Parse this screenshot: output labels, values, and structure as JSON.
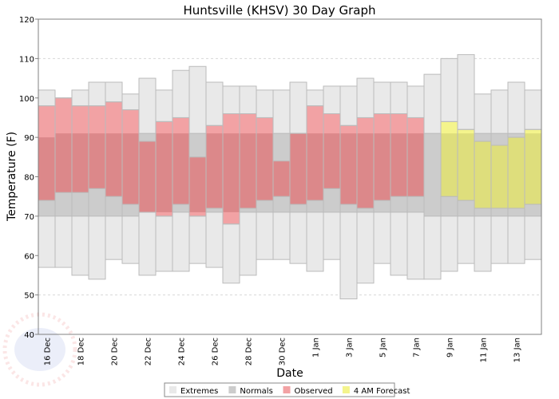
{
  "chart_data": {
    "type": "bar",
    "subtype": "floating-range",
    "title": "Huntsville (KHSV) 30 Day Graph",
    "xlabel": "Date",
    "ylabel": "Temperature (F)",
    "ylim": [
      40,
      120
    ],
    "yticks": [
      40,
      50,
      60,
      70,
      80,
      90,
      100,
      110,
      120
    ],
    "grid": true,
    "legend_position": "bottom-center",
    "legend": [
      {
        "key": "extremes",
        "label": "Extremes",
        "color": "#E9E9E9"
      },
      {
        "key": "normals",
        "label": "Normals",
        "color": "#CCCCCC"
      },
      {
        "key": "observed",
        "label": "Observed",
        "color": "#F2A2A4"
      },
      {
        "key": "forecast",
        "label": "4 AM Forecast",
        "color": "#F4F48C"
      }
    ],
    "colors": {
      "extremes": "#E9E9E9",
      "normals": "#CCCCCC",
      "observed": "#F2A2A4",
      "observed_overlap": "#DC888A",
      "forecast": "#F4F48C",
      "forecast_overlap": "#DEDE7C",
      "border": "#BBBBBB",
      "axis": "#808080",
      "grid": "#D8D8D8"
    },
    "categories": [
      "16 Dec",
      "17 Dec",
      "18 Dec",
      "19 Dec",
      "20 Dec",
      "21 Dec",
      "22 Dec",
      "23 Dec",
      "24 Dec",
      "25 Dec",
      "26 Dec",
      "27 Dec",
      "28 Dec",
      "29 Dec",
      "30 Dec",
      "31 Dec",
      "1 Jan",
      "2 Jan",
      "3 Jan",
      "4 Jan",
      "5 Jan",
      "6 Jan",
      "7 Jan",
      "8 Jan",
      "9 Jan",
      "10 Jan",
      "11 Jan",
      "12 Jan",
      "13 Jan",
      "14 Jan"
    ],
    "tick_labels": [
      "16 Dec",
      "",
      "18 Dec",
      "",
      "20 Dec",
      "",
      "22 Dec",
      "",
      "24 Dec",
      "",
      "26 Dec",
      "",
      "28 Dec",
      "",
      "30 Dec",
      "",
      "1 Jan",
      "",
      "3 Jan",
      "",
      "5 Jan",
      "",
      "7 Jan",
      "",
      "9 Jan",
      "",
      "11 Jan",
      "",
      "13 Jan",
      ""
    ],
    "series": [
      {
        "name": "Extremes",
        "low": [
          57,
          57,
          55,
          54,
          59,
          58,
          55,
          56,
          56,
          58,
          57,
          53,
          55,
          59,
          59,
          58,
          56,
          59,
          49,
          53,
          58,
          55,
          54,
          54,
          56,
          58,
          56,
          58,
          58,
          59
        ],
        "high": [
          102,
          100,
          102,
          104,
          104,
          101,
          105,
          102,
          107,
          108,
          104,
          103,
          103,
          102,
          102,
          104,
          102,
          103,
          103,
          105,
          104,
          104,
          103,
          106,
          110,
          111,
          101,
          102,
          104,
          102
        ]
      },
      {
        "name": "Normals",
        "low": [
          70,
          70,
          70,
          70,
          70,
          70,
          71,
          71,
          71,
          71,
          71,
          71,
          71,
          71,
          71,
          71,
          71,
          71,
          71,
          71,
          71,
          71,
          71,
          70,
          70,
          70,
          70,
          70,
          70,
          70
        ],
        "high": [
          90,
          91,
          91,
          91,
          91,
          91,
          91,
          91,
          91,
          91,
          91,
          91,
          91,
          91,
          91,
          91,
          91,
          91,
          91,
          91,
          91,
          91,
          91,
          91,
          91,
          91,
          91,
          91,
          91,
          91
        ]
      },
      {
        "name": "Observed",
        "low": [
          74,
          76,
          76,
          77,
          75,
          73,
          71,
          70,
          73,
          70,
          72,
          68,
          72,
          74,
          75,
          73,
          74,
          77,
          73,
          72,
          74,
          75,
          75,
          null,
          null,
          null,
          null,
          null,
          null,
          null
        ],
        "high": [
          98,
          100,
          98,
          98,
          99,
          97,
          89,
          94,
          95,
          85,
          93,
          96,
          96,
          95,
          84,
          91,
          98,
          96,
          93,
          95,
          96,
          96,
          95,
          null,
          null,
          null,
          null,
          null,
          null,
          null
        ]
      },
      {
        "name": "4 AM Forecast",
        "low": [
          null,
          null,
          null,
          null,
          null,
          null,
          null,
          null,
          null,
          null,
          null,
          null,
          null,
          null,
          null,
          null,
          null,
          null,
          null,
          null,
          null,
          null,
          null,
          null,
          75,
          74,
          72,
          72,
          72,
          73
        ],
        "high": [
          null,
          null,
          null,
          null,
          null,
          null,
          null,
          null,
          null,
          null,
          null,
          null,
          null,
          null,
          null,
          null,
          null,
          null,
          null,
          null,
          null,
          null,
          null,
          null,
          94,
          92,
          89,
          88,
          90,
          92
        ]
      }
    ]
  }
}
